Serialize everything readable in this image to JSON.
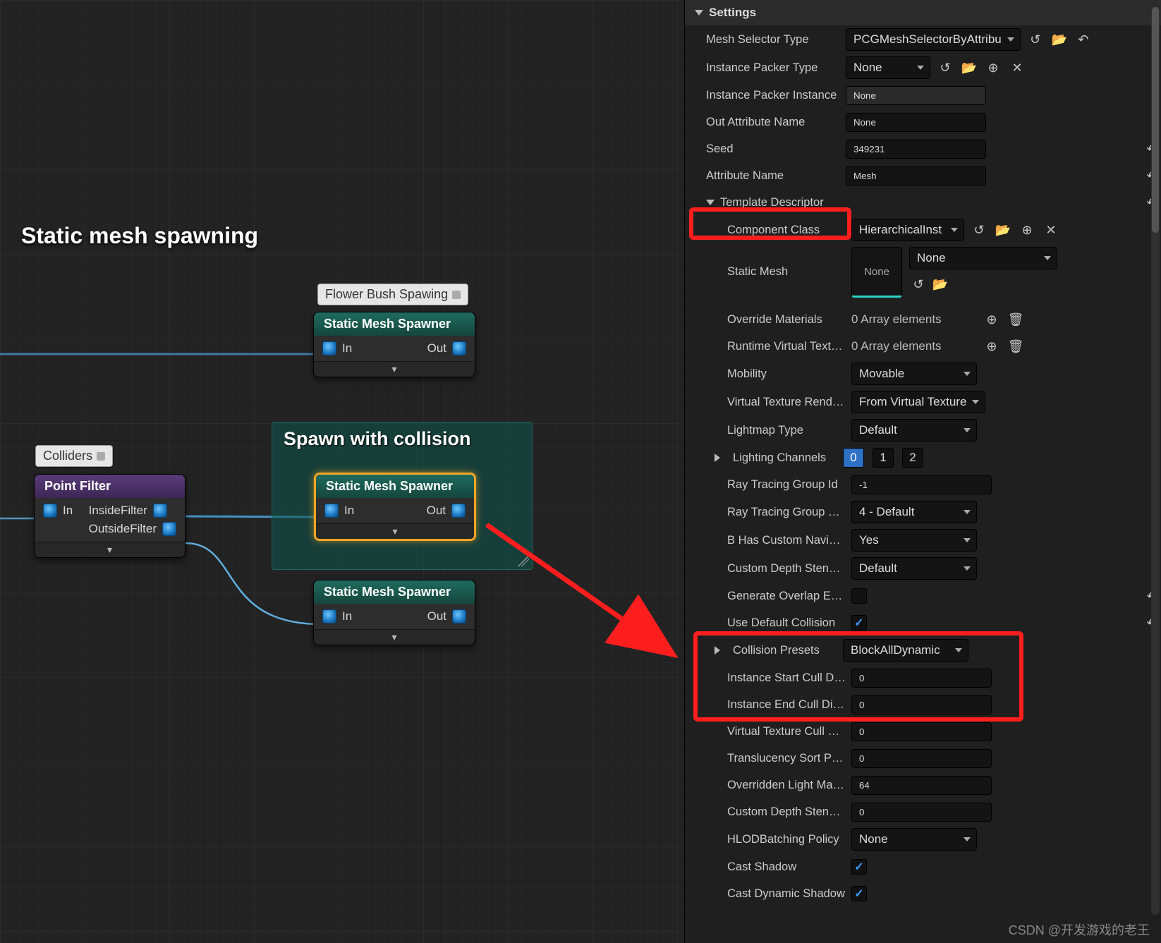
{
  "graph": {
    "section_title": "Static mesh spawning",
    "note_flower": "Flower Bush Spawing",
    "note_colliders": "Colliders",
    "comment_spawn_collision": "Spawn with collision",
    "node_sms": "Static Mesh Spawner",
    "node_pf": "Point Filter",
    "pin_in": "In",
    "pin_out": "Out",
    "pin_inside": "InsideFilter",
    "pin_outside": "OutsideFilter"
  },
  "panel": {
    "settings": "Settings",
    "mesh_selector_type": {
      "label": "Mesh Selector Type",
      "value": "PCGMeshSelectorByAttribu"
    },
    "instance_packer_type": {
      "label": "Instance Packer Type",
      "value": "None"
    },
    "instance_packer_instance": {
      "label": "Instance Packer Instance",
      "value": "None"
    },
    "out_attribute_name": {
      "label": "Out Attribute Name",
      "value": "None"
    },
    "seed": {
      "label": "Seed",
      "value": "349231"
    },
    "attribute_name": {
      "label": "Attribute Name",
      "value": "Mesh"
    },
    "template_descriptor": "Template Descriptor",
    "component_class": {
      "label": "Component Class",
      "value": "HierarchicalInst"
    },
    "static_mesh": {
      "label": "Static Mesh",
      "thumb": "None",
      "sel": "None"
    },
    "override_materials": {
      "label": "Override Materials",
      "value": "0 Array elements"
    },
    "runtime_virtual_textures": {
      "label": "Runtime Virtual Textures",
      "value": "0 Array elements"
    },
    "mobility": {
      "label": "Mobility",
      "value": "Movable"
    },
    "vtrp": {
      "label": "Virtual Texture Render Pa...",
      "value": "From Virtual Texture"
    },
    "lightmap_type": {
      "label": "Lightmap Type",
      "value": "Default"
    },
    "lighting_channels": {
      "label": "Lighting Channels",
      "c0": "0",
      "c1": "1",
      "c2": "2"
    },
    "ray_group_id": {
      "label": "Ray Tracing Group Id",
      "value": "-1"
    },
    "ray_group_cull": {
      "label": "Ray Tracing Group Cullin...",
      "value": "4 - Default"
    },
    "has_nav": {
      "label": "B Has Custom Navigable...",
      "value": "Yes"
    },
    "cds_write": {
      "label": "Custom Depth Stencil Wri...",
      "value": "Default"
    },
    "gen_overlap": {
      "label": "Generate Overlap Events"
    },
    "use_def_col": {
      "label": "Use Default Collision"
    },
    "col_presets": {
      "label": "Collision Presets",
      "value": "BlockAllDynamic"
    },
    "inst_start_cull": {
      "label": "Instance Start Cull Distan...",
      "value": "0"
    },
    "inst_end_cull": {
      "label": "Instance End Cull Distance",
      "value": "0"
    },
    "vt_cull_mips": {
      "label": "Virtual Texture Cull Mips",
      "value": "0"
    },
    "trans_sort": {
      "label": "Translucency Sort Priority",
      "value": "0"
    },
    "olm_res": {
      "label": "Overridden Light Map Res",
      "value": "64"
    },
    "cds_val": {
      "label": "Custom Depth Stencil Val...",
      "value": "0"
    },
    "hlod": {
      "label": "HLODBatching Policy",
      "value": "None"
    },
    "cast_shadow": {
      "label": "Cast Shadow"
    },
    "cast_dyn_shadow": {
      "label": "Cast Dynamic Shadow"
    }
  },
  "watermark": "CSDN @开发游戏的老王"
}
